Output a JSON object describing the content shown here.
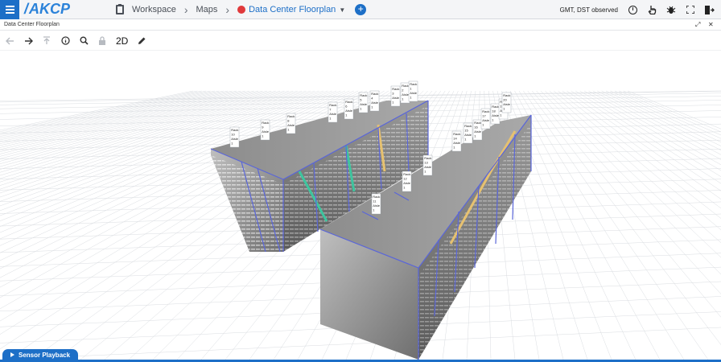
{
  "app": {
    "logo": "AKCP"
  },
  "breadcrumb": {
    "workspace": "Workspace",
    "maps": "Maps",
    "current": "Data Center Floorplan"
  },
  "status": {
    "timezone": "GMT, DST observed"
  },
  "panel": {
    "title": "Data Center Floorplan"
  },
  "toolbar": {
    "view_toggle": "2D"
  },
  "playback": {
    "label": "Sensor Playback"
  },
  "colors": {
    "accent": "#1d6fc7",
    "status_dot": "#e0393b"
  },
  "racks": [
    {
      "lines": [
        "Rack",
        "10",
        "Aisle",
        "1"
      ]
    },
    {
      "lines": [
        "Rack",
        "9",
        "Aisle",
        "1"
      ]
    },
    {
      "lines": [
        "Rack",
        "8",
        "Aisle",
        "1"
      ]
    },
    {
      "lines": [
        "Rack",
        "7",
        "Aisle",
        "1"
      ]
    },
    {
      "lines": [
        "Rack",
        "6",
        "Aisle",
        "1"
      ]
    },
    {
      "lines": [
        "Rack",
        "5",
        "Aisle",
        "1"
      ]
    },
    {
      "lines": [
        "Rack",
        "4",
        "Aisle",
        "1"
      ]
    },
    {
      "lines": [
        "Rack",
        "3",
        "Aisle",
        "1"
      ]
    },
    {
      "lines": [
        "Rack",
        "2",
        "Aisle",
        "1"
      ]
    },
    {
      "lines": [
        "Rack",
        "1",
        "Aisle",
        "1"
      ]
    },
    {
      "lines": [
        "Rack",
        "11",
        "Aisle",
        "1"
      ]
    },
    {
      "lines": [
        "Rack",
        "12",
        "Aisle",
        "1"
      ]
    },
    {
      "lines": [
        "Rack",
        "13",
        "Aisle",
        "1"
      ]
    },
    {
      "lines": [
        "Rack",
        "14",
        "Aisle",
        "1"
      ]
    },
    {
      "lines": [
        "Rack",
        "15",
        "Aisle",
        "1"
      ]
    },
    {
      "lines": [
        "Rack",
        "16",
        "Aisle",
        "1"
      ]
    },
    {
      "lines": [
        "Rack",
        "17",
        "Aisle",
        "1"
      ]
    },
    {
      "lines": [
        "Rack",
        "18",
        "Aisle",
        "1"
      ]
    },
    {
      "lines": [
        "Rack",
        "19",
        "Aisle",
        "1"
      ]
    },
    {
      "lines": [
        "Rack",
        "20",
        "Aisle",
        "1"
      ]
    }
  ]
}
